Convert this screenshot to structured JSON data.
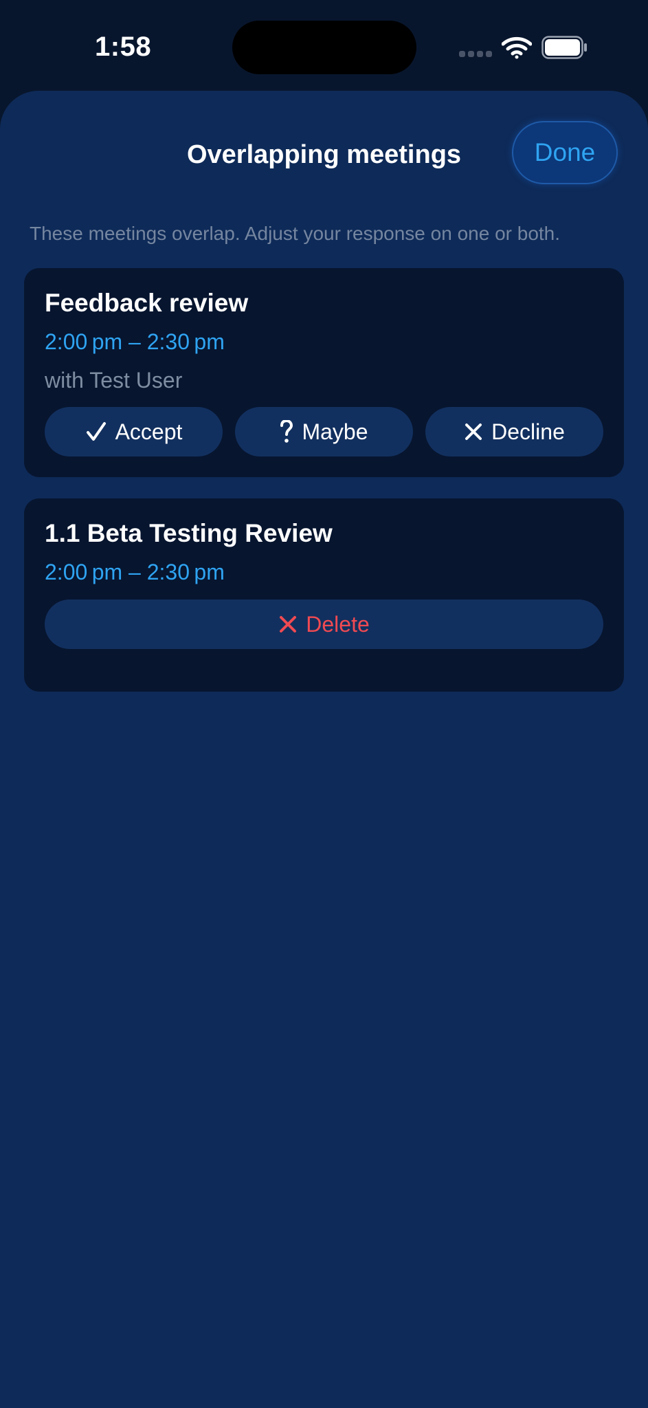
{
  "status_bar": {
    "time": "1:58",
    "icons": [
      "cellular-signal-icon",
      "wifi-icon",
      "battery-icon"
    ]
  },
  "sheet": {
    "title": "Overlapping meetings",
    "done_label": "Done",
    "subtitle": "These meetings overlap. Adjust your response on one or both."
  },
  "meetings": [
    {
      "title": "Feedback review",
      "time": "2:00 pm – 2:30 pm",
      "attendees": "with Test User",
      "actions": {
        "accept": {
          "label": "Accept",
          "icon": "checkmark-icon"
        },
        "maybe": {
          "label": "Maybe",
          "icon": "question-mark-icon"
        },
        "decline": {
          "label": "Decline",
          "icon": "x-mark-icon"
        }
      }
    },
    {
      "title": "1.1 Beta Testing Review",
      "time": "2:00 pm – 2:30 pm",
      "actions": {
        "delete": {
          "label": "Delete",
          "icon": "x-mark-icon"
        }
      }
    }
  ],
  "colors": {
    "background": "#08162d",
    "sheet": "#0e2a58",
    "card": "#07152f",
    "pill": "#12305f",
    "accent_blue": "#2fa4f2",
    "destructive_red": "#f04a52",
    "secondary_text": "#7f8da2"
  }
}
